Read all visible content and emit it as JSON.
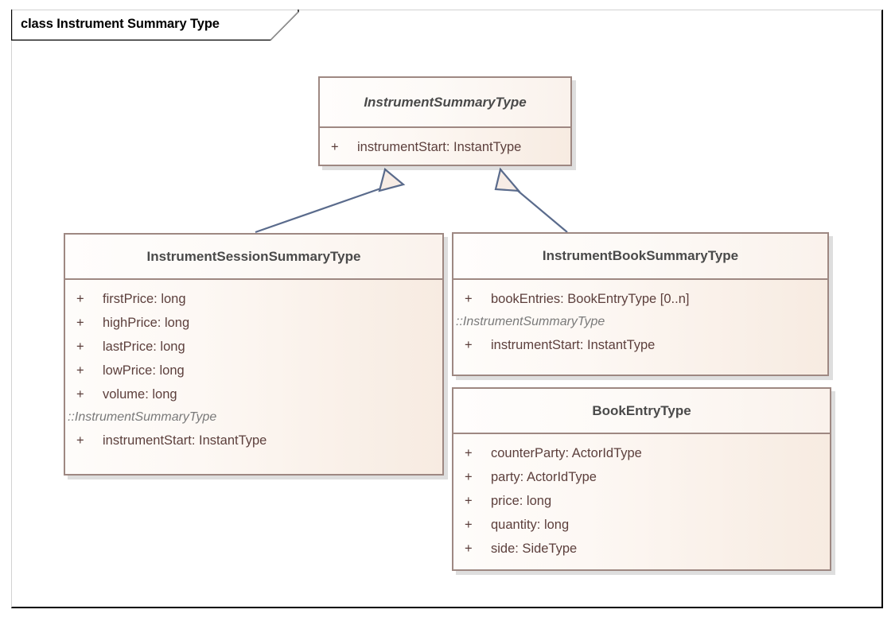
{
  "frame": {
    "label": "class Instrument Summary Type"
  },
  "classes": [
    {
      "id": "instrument-summary-type",
      "name": "InstrumentSummaryType",
      "abstract": true,
      "attributes": [
        {
          "visibility": "+",
          "text": "instrumentStart: InstantType"
        }
      ],
      "inherited": []
    },
    {
      "id": "instrument-session-summary-type",
      "name": "InstrumentSessionSummaryType",
      "abstract": false,
      "attributes": [
        {
          "visibility": "+",
          "text": "firstPrice: long"
        },
        {
          "visibility": "+",
          "text": "highPrice: long"
        },
        {
          "visibility": "+",
          "text": "lastPrice: long"
        },
        {
          "visibility": "+",
          "text": "lowPrice: long"
        },
        {
          "visibility": "+",
          "text": "volume: long"
        }
      ],
      "inherited": [
        {
          "label": "::InstrumentSummaryType",
          "attributes": [
            {
              "visibility": "+",
              "text": "instrumentStart: InstantType"
            }
          ]
        }
      ]
    },
    {
      "id": "instrument-book-summary-type",
      "name": "InstrumentBookSummaryType",
      "abstract": false,
      "attributes": [
        {
          "visibility": "+",
          "text": "bookEntries: BookEntryType [0..n]"
        }
      ],
      "inherited": [
        {
          "label": "::InstrumentSummaryType",
          "attributes": [
            {
              "visibility": "+",
              "text": "instrumentStart: InstantType"
            }
          ]
        }
      ]
    },
    {
      "id": "book-entry-type",
      "name": "BookEntryType",
      "abstract": false,
      "attributes": [
        {
          "visibility": "+",
          "text": "counterParty: ActorIdType"
        },
        {
          "visibility": "+",
          "text": "party: ActorIdType"
        },
        {
          "visibility": "+",
          "text": "price: long"
        },
        {
          "visibility": "+",
          "text": "quantity: long"
        },
        {
          "visibility": "+",
          "text": "side: SideType"
        }
      ],
      "inherited": []
    }
  ],
  "relationships": [
    {
      "type": "generalization",
      "from": "InstrumentSessionSummaryType",
      "to": "InstrumentSummaryType"
    },
    {
      "type": "generalization",
      "from": "InstrumentBookSummaryType",
      "to": "InstrumentSummaryType"
    }
  ],
  "colors": {
    "class_border": "#9e8882",
    "class_fill_light": "#fefcfa",
    "class_fill_tint": "#f7ebe1",
    "header_text": "#4a4a4a",
    "attribute_text": "#5c3f3c",
    "inherited_label_text": "#7a7a7a",
    "connector_line": "#5a6b8c",
    "arrowhead_fill": "#f7ece5",
    "frame_border_dark": "#000000",
    "frame_border_light": "#d2d2d2"
  }
}
